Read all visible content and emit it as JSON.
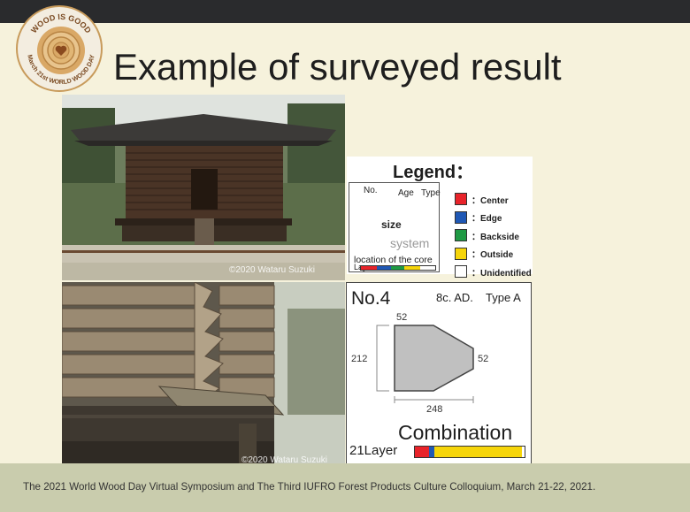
{
  "slide": {
    "title": "Example of surveyed result",
    "footer": "The 2021 World Wood Day Virtual Symposium and The Third IUFRO Forest Products Culture Colloquium, March 21-22, 2021."
  },
  "logo": {
    "text_top": "WOOD IS GOOD",
    "text_bottom": "March 21st WORLD WOOD DAY",
    "icon": "heart-icon"
  },
  "photos": {
    "top": {
      "credit": "©2020 Wataru Suzuki",
      "subject": "log storehouse"
    },
    "bottom": {
      "credit": "©2020 Wataru Suzuki",
      "subject": "interlocked log corner"
    }
  },
  "legend": {
    "title": "Legend：",
    "box": {
      "no_label": "No.",
      "age_label": "Age",
      "type_label": "Type",
      "size_label": "size",
      "system_label": "system",
      "core_label": "location of the core",
      "layers_label": "Layers"
    },
    "items": [
      {
        "label": "：Center",
        "color": "#e8232a"
      },
      {
        "label": "：Edge",
        "color": "#1f58b5"
      },
      {
        "label": "：Backside",
        "color": "#1f9a44"
      },
      {
        "label": "：Outside",
        "color": "#f6d50a"
      },
      {
        "label": "：Unidentified",
        "color": "#ffffff"
      }
    ]
  },
  "sample": {
    "no": "No.4",
    "age": "8c. AD.",
    "type": "Type A",
    "dim_top": "52",
    "dim_left": "212",
    "dim_right": "52",
    "dim_bottom": "248",
    "system": "Combination",
    "layers": "21Layer"
  },
  "colors": {
    "slide_bg": "#f6f2dc",
    "footer_bg": "#c9ccad",
    "topbar": "#2a2b2d",
    "section_fill": "#c0c0c0"
  }
}
